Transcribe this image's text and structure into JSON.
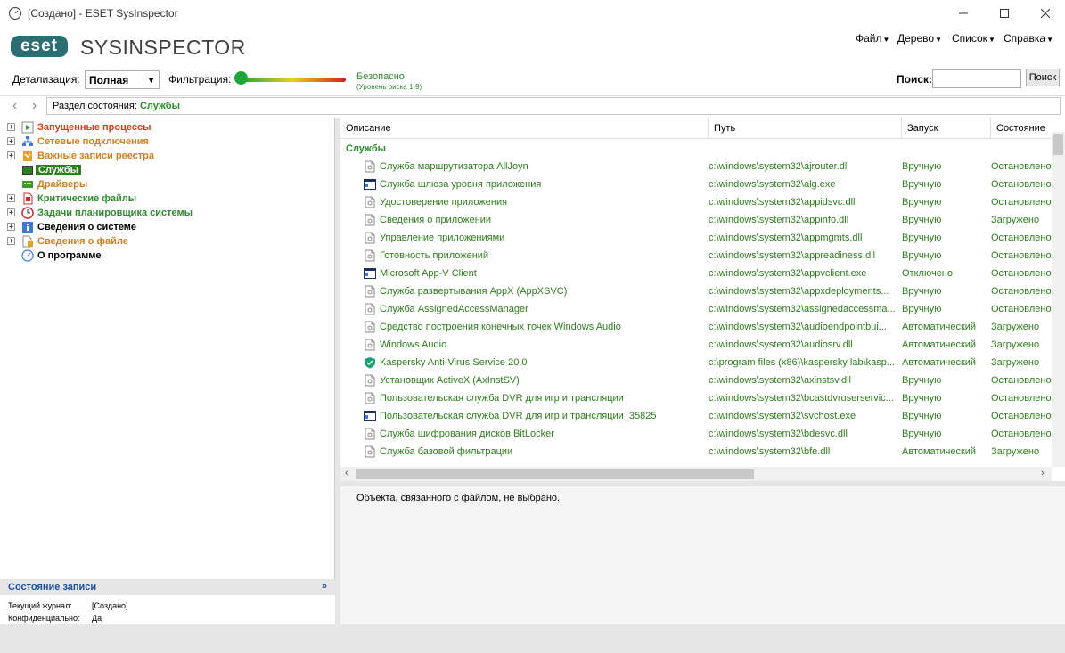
{
  "window": {
    "title": "[Создано] - ESET SysInspector"
  },
  "brand": {
    "logo": "eset",
    "product": "SYSINSPECTOR"
  },
  "menu": [
    {
      "label": "Файл"
    },
    {
      "label": "Дерево"
    },
    {
      "label": "Список"
    },
    {
      "label": "Справка"
    }
  ],
  "toolbar": {
    "detail_label": "Детализация:",
    "detail_value": "Полная",
    "filter_label": "Фильтрация:",
    "filter_state": "Безопасно",
    "filter_sub": "(Уровень риска 1-9)",
    "search_label": "Поиск:",
    "search_value": "",
    "search_button": "Поиск"
  },
  "breadcrumb": {
    "prefix": "Раздел состояния:",
    "value": "Службы"
  },
  "tree": [
    {
      "label": "Запущенные процессы",
      "color": "#d04020",
      "icon": "play-icon",
      "expandable": true
    },
    {
      "label": "Сетевые подключения",
      "color": "#d08020",
      "icon": "network-icon",
      "expandable": true
    },
    {
      "label": "Важные записи реестра",
      "color": "#d08020",
      "icon": "registry-icon",
      "expandable": true
    },
    {
      "label": "Службы",
      "color": "#ffffff",
      "icon": "services-icon",
      "expandable": false,
      "selected": true
    },
    {
      "label": "Драйверы",
      "color": "#d08020",
      "icon": "driver-icon",
      "expandable": false
    },
    {
      "label": "Критические файлы",
      "color": "#2e8b2e",
      "icon": "critical-file-icon",
      "expandable": true
    },
    {
      "label": "Задачи планировщика системы",
      "color": "#2e8b2e",
      "icon": "clock-icon",
      "expandable": true
    },
    {
      "label": "Сведения о системе",
      "color": "#000000",
      "icon": "system-info-icon",
      "expandable": true
    },
    {
      "label": "Сведения о файле",
      "color": "#d08020",
      "icon": "file-info-icon",
      "expandable": true
    },
    {
      "label": "О программе",
      "color": "#000000",
      "icon": "about-icon",
      "expandable": false
    }
  ],
  "status_panel": {
    "title": "Состояние записи",
    "rows": [
      {
        "key": "Текущий журнал:",
        "value": "[Создано]"
      },
      {
        "key": "Конфиденциально:",
        "value": "Да"
      }
    ]
  },
  "columns": [
    "Описание",
    "Путь",
    "Запуск",
    "Состояние"
  ],
  "group": "Службы",
  "rows": [
    {
      "icon": "doc-icon",
      "desc": "Служба маршрутизатора AllJoyn",
      "path": "c:\\windows\\system32\\ajrouter.dll",
      "start": "Вручную",
      "state": "Остановлено"
    },
    {
      "icon": "window-icon",
      "desc": "Служба шлюза уровня приложения",
      "path": "c:\\windows\\system32\\alg.exe",
      "start": "Вручную",
      "state": "Остановлено"
    },
    {
      "icon": "doc-icon",
      "desc": "Удостоверение приложения",
      "path": "c:\\windows\\system32\\appidsvc.dll",
      "start": "Вручную",
      "state": "Остановлено"
    },
    {
      "icon": "doc-icon",
      "desc": "Сведения о приложении",
      "path": "c:\\windows\\system32\\appinfo.dll",
      "start": "Вручную",
      "state": "Загружено"
    },
    {
      "icon": "doc-icon",
      "desc": "Управление приложениями",
      "path": "c:\\windows\\system32\\appmgmts.dll",
      "start": "Вручную",
      "state": "Остановлено"
    },
    {
      "icon": "doc-icon",
      "desc": "Готовность приложений",
      "path": "c:\\windows\\system32\\appreadiness.dll",
      "start": "Вручную",
      "state": "Остановлено"
    },
    {
      "icon": "window-icon",
      "desc": "Microsoft App-V Client",
      "path": "c:\\windows\\system32\\appvclient.exe",
      "start": "Отключено",
      "state": "Остановлено"
    },
    {
      "icon": "doc-icon",
      "desc": "Служба развертывания AppX (AppXSVC)",
      "path": "c:\\windows\\system32\\appxdeployments...",
      "start": "Вручную",
      "state": "Остановлено"
    },
    {
      "icon": "doc-icon",
      "desc": "Служба AssignedAccessManager",
      "path": "c:\\windows\\system32\\assignedaccessma...",
      "start": "Вручную",
      "state": "Остановлено"
    },
    {
      "icon": "doc-icon",
      "desc": "Средство построения конечных точек Windows Audio",
      "path": "c:\\windows\\system32\\audioendpointbui...",
      "start": "Автоматический",
      "state": "Загружено"
    },
    {
      "icon": "doc-icon",
      "desc": "Windows Audio",
      "path": "c:\\windows\\system32\\audiosrv.dll",
      "start": "Автоматический",
      "state": "Загружено"
    },
    {
      "icon": "shield-icon",
      "desc": "Kaspersky Anti-Virus Service 20.0",
      "path": "c:\\program files (x86)\\kaspersky lab\\kasp...",
      "start": "Автоматический",
      "state": "Загружено"
    },
    {
      "icon": "doc-icon",
      "desc": "Установщик ActiveX (AxInstSV)",
      "path": "c:\\windows\\system32\\axinstsv.dll",
      "start": "Вручную",
      "state": "Остановлено"
    },
    {
      "icon": "doc-icon",
      "desc": "Пользовательская служба DVR для игр и трансляции",
      "path": "c:\\windows\\system32\\bcastdvruserservic...",
      "start": "Вручную",
      "state": "Остановлено"
    },
    {
      "icon": "window-icon",
      "desc": "Пользовательская служба DVR для игр и трансляции_35825",
      "path": "c:\\windows\\system32\\svchost.exe",
      "start": "Вручную",
      "state": "Остановлено"
    },
    {
      "icon": "doc-icon",
      "desc": "Служба шифрования дисков BitLocker",
      "path": "c:\\windows\\system32\\bdesvc.dll",
      "start": "Вручную",
      "state": "Остановлено"
    },
    {
      "icon": "doc-icon",
      "desc": "Служба базовой фильтрации",
      "path": "c:\\windows\\system32\\bfe.dll",
      "start": "Автоматический",
      "state": "Загружено"
    }
  ],
  "detail": {
    "message": "Объекта, связанного с файлом, не выбрано."
  }
}
